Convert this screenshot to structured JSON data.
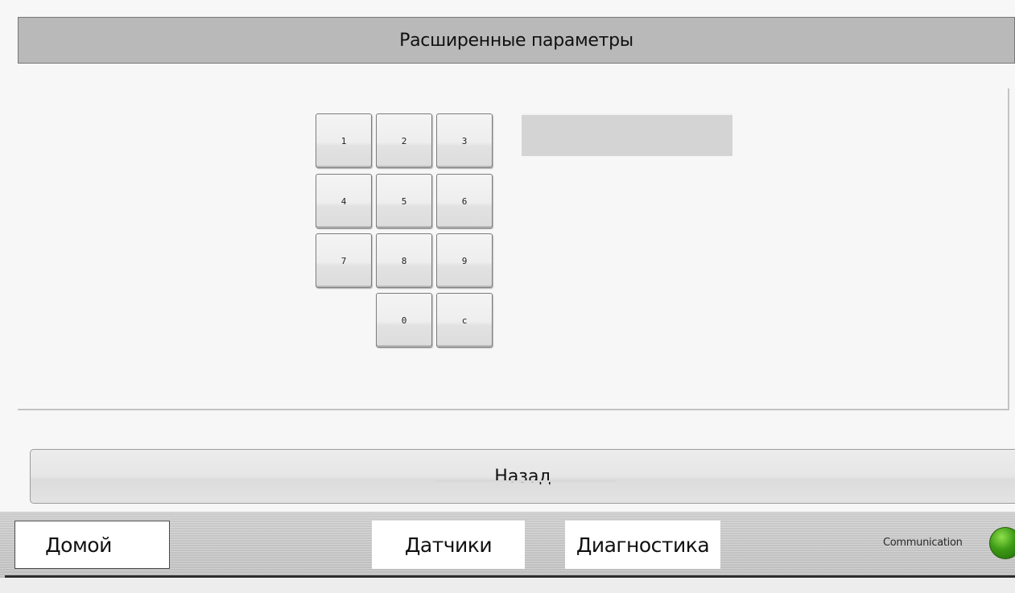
{
  "header": {
    "title": "Расширенные параметры"
  },
  "keypad": {
    "keys": [
      "1",
      "2",
      "3",
      "4",
      "5",
      "6",
      "7",
      "8",
      "9",
      "0",
      "c"
    ]
  },
  "display": {
    "value": ""
  },
  "back_button": {
    "label": "Назад"
  },
  "nav": {
    "home_label": "Домой",
    "sensors_label": "Датчики",
    "diagnostics_label": "Диагностика"
  },
  "status": {
    "communication_label": "Communication",
    "communication_color": "#3d9a16"
  }
}
